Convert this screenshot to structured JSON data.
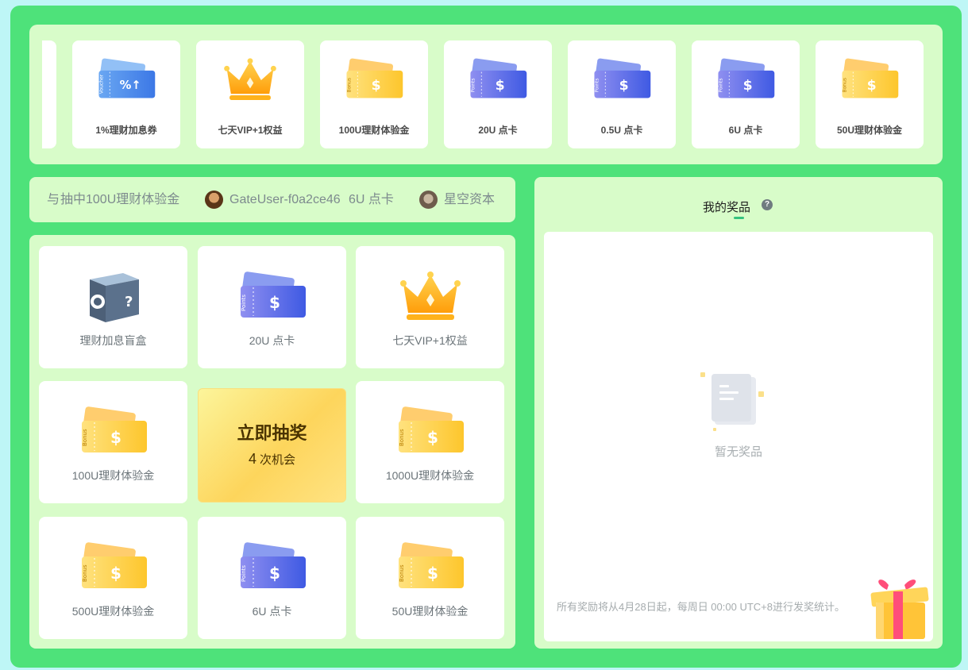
{
  "top_cards": [
    {
      "label": "1%理财加息券",
      "icon": "percent-coupon-icon"
    },
    {
      "label": "七天VIP+1权益",
      "icon": "crown-icon"
    },
    {
      "label": "100U理财体验金",
      "icon": "bonus-ticket-icon"
    },
    {
      "label": "20U 点卡",
      "icon": "points-ticket-icon"
    },
    {
      "label": "0.5U 点卡",
      "icon": "points-ticket-icon"
    },
    {
      "label": "6U 点卡",
      "icon": "points-ticket-icon"
    },
    {
      "label": "50U理财体验金",
      "icon": "bonus-ticket-icon"
    }
  ],
  "ticker": {
    "lead_fragment": "与",
    "item1_text": "抽中100U理财体验金",
    "item2_user": "GateUser-f0a2ce46",
    "item2_prize": "6U 点卡",
    "item3_user": "星空资本"
  },
  "grid": {
    "cells": [
      {
        "label": "理财加息盲盒",
        "icon": "blind-box-icon"
      },
      {
        "label": "20U 点卡",
        "icon": "points-ticket-icon"
      },
      {
        "label": "七天VIP+1权益",
        "icon": "crown-icon"
      },
      {
        "label": "100U理财体验金",
        "icon": "bonus-ticket-icon"
      },
      {
        "label": "1000U理财体验金",
        "icon": "bonus-ticket-icon"
      },
      {
        "label": "500U理财体验金",
        "icon": "bonus-ticket-icon"
      },
      {
        "label": "6U 点卡",
        "icon": "points-ticket-icon"
      },
      {
        "label": "50U理财体验金",
        "icon": "bonus-ticket-icon"
      }
    ],
    "draw_button": {
      "title": "立即抽奖",
      "count": "4",
      "count_suffix": "次机会"
    }
  },
  "prizes": {
    "title": "我的奖品",
    "help": "?",
    "empty_text": "暂无奖品",
    "note": "所有奖励将从4月28日起，每周日 00:00 UTC+8进行发奖统计。"
  },
  "colors": {
    "frame": "#4ee27a",
    "panel": "#d8fcc9",
    "accent": "#35c27f",
    "bonus_gold": "#fdc62c",
    "points_blue": "#4c6ae6"
  }
}
